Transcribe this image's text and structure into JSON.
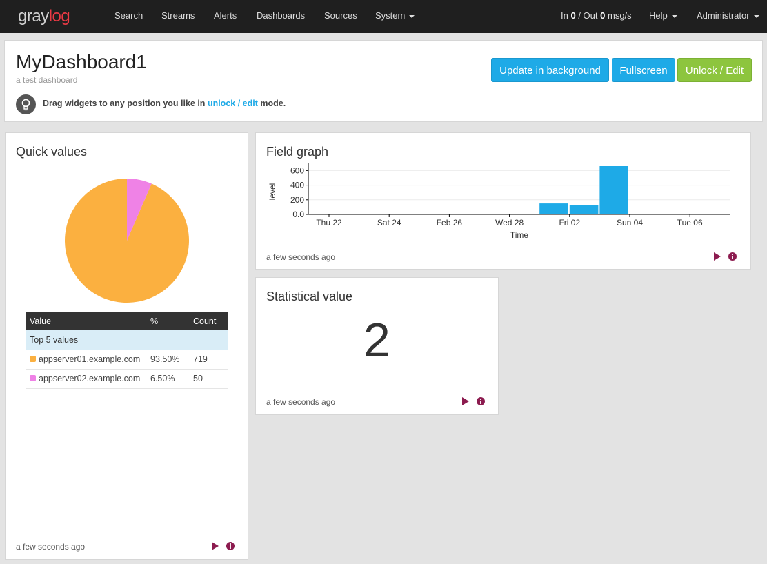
{
  "brand": {
    "part1": "gray",
    "part2": "log"
  },
  "nav": {
    "items": [
      "Search",
      "Streams",
      "Alerts",
      "Dashboards",
      "Sources",
      "System"
    ],
    "throughput": {
      "in_label": "In",
      "in_value": "0",
      "sep": "/ Out",
      "out_value": "0",
      "unit": "msg/s"
    },
    "help": "Help",
    "user": "Administrator"
  },
  "dashboard": {
    "title": "MyDashboard1",
    "description": "a test dashboard",
    "buttons": {
      "update": "Update in background",
      "fullscreen": "Fullscreen",
      "unlock": "Unlock / Edit"
    },
    "hint": {
      "before": "Drag widgets to any position you like in",
      "link": "unlock / edit",
      "after": "mode."
    }
  },
  "colors": {
    "accent": "#1eaae7",
    "success": "#8dc53e",
    "brand_red": "#ec3a45",
    "action_icon": "#8c1b4f",
    "pie_orange": "#fbb040",
    "pie_pink": "#ef82e6"
  },
  "widgets": {
    "quick_values": {
      "title": "Quick values",
      "table": {
        "headers": [
          "Value",
          "%",
          "Count"
        ],
        "group_label": "Top 5 values",
        "rows": [
          {
            "value": "appserver01.example.com",
            "percent": "93.50%",
            "count": "719",
            "color": "#fbb040"
          },
          {
            "value": "appserver02.example.com",
            "percent": "6.50%",
            "count": "50",
            "color": "#ef82e6"
          }
        ]
      },
      "timestamp": "a few seconds ago",
      "icons": [
        "play-icon",
        "info-icon"
      ]
    },
    "field_graph": {
      "title": "Field graph",
      "timestamp": "a few seconds ago",
      "icons": [
        "play-icon",
        "info-icon"
      ]
    },
    "statistical_value": {
      "title": "Statistical value",
      "value": "2",
      "timestamp": "a few seconds ago",
      "icons": [
        "play-icon",
        "info-icon"
      ]
    }
  },
  "chart_data": [
    {
      "type": "pie",
      "categories": [
        "appserver01.example.com",
        "appserver02.example.com"
      ],
      "values": [
        719,
        50
      ],
      "colors": [
        "#fbb040",
        "#ef82e6"
      ]
    },
    {
      "type": "bar",
      "title": "",
      "xlabel": "Time",
      "ylabel": "level",
      "x_ticks": [
        "Thu 22",
        "Sat 24",
        "Feb 26",
        "Wed 28",
        "Fri 02",
        "Sun 04",
        "Tue 06"
      ],
      "y_ticks": [
        "0.0",
        "200",
        "400",
        "600"
      ],
      "ylim": [
        0,
        660
      ],
      "grid": true,
      "bar_color": "#1eaae7",
      "series": [
        {
          "bins": [
            {
              "start": "Thu 01",
              "end": "Fri 02",
              "value": 150
            },
            {
              "start": "Fri 02",
              "end": "Sat 03",
              "value": 130
            },
            {
              "start": "Sat 03",
              "end": "Sun 04",
              "value": 660
            }
          ]
        }
      ]
    }
  ]
}
